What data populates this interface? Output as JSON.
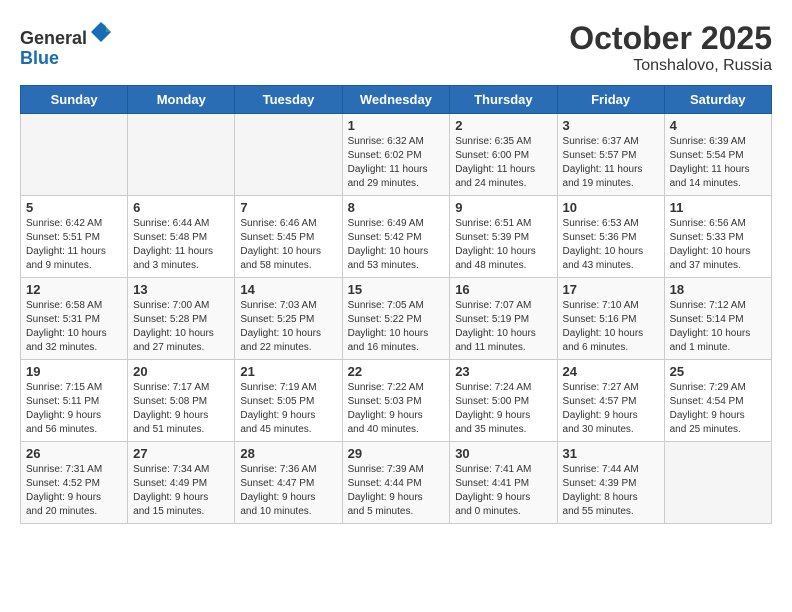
{
  "header": {
    "logo_general": "General",
    "logo_blue": "Blue",
    "title": "October 2025",
    "subtitle": "Tonshalovo, Russia"
  },
  "columns": [
    "Sunday",
    "Monday",
    "Tuesday",
    "Wednesday",
    "Thursday",
    "Friday",
    "Saturday"
  ],
  "weeks": [
    [
      {
        "day": "",
        "info": ""
      },
      {
        "day": "",
        "info": ""
      },
      {
        "day": "",
        "info": ""
      },
      {
        "day": "1",
        "info": "Sunrise: 6:32 AM\nSunset: 6:02 PM\nDaylight: 11 hours\nand 29 minutes."
      },
      {
        "day": "2",
        "info": "Sunrise: 6:35 AM\nSunset: 6:00 PM\nDaylight: 11 hours\nand 24 minutes."
      },
      {
        "day": "3",
        "info": "Sunrise: 6:37 AM\nSunset: 5:57 PM\nDaylight: 11 hours\nand 19 minutes."
      },
      {
        "day": "4",
        "info": "Sunrise: 6:39 AM\nSunset: 5:54 PM\nDaylight: 11 hours\nand 14 minutes."
      }
    ],
    [
      {
        "day": "5",
        "info": "Sunrise: 6:42 AM\nSunset: 5:51 PM\nDaylight: 11 hours\nand 9 minutes."
      },
      {
        "day": "6",
        "info": "Sunrise: 6:44 AM\nSunset: 5:48 PM\nDaylight: 11 hours\nand 3 minutes."
      },
      {
        "day": "7",
        "info": "Sunrise: 6:46 AM\nSunset: 5:45 PM\nDaylight: 10 hours\nand 58 minutes."
      },
      {
        "day": "8",
        "info": "Sunrise: 6:49 AM\nSunset: 5:42 PM\nDaylight: 10 hours\nand 53 minutes."
      },
      {
        "day": "9",
        "info": "Sunrise: 6:51 AM\nSunset: 5:39 PM\nDaylight: 10 hours\nand 48 minutes."
      },
      {
        "day": "10",
        "info": "Sunrise: 6:53 AM\nSunset: 5:36 PM\nDaylight: 10 hours\nand 43 minutes."
      },
      {
        "day": "11",
        "info": "Sunrise: 6:56 AM\nSunset: 5:33 PM\nDaylight: 10 hours\nand 37 minutes."
      }
    ],
    [
      {
        "day": "12",
        "info": "Sunrise: 6:58 AM\nSunset: 5:31 PM\nDaylight: 10 hours\nand 32 minutes."
      },
      {
        "day": "13",
        "info": "Sunrise: 7:00 AM\nSunset: 5:28 PM\nDaylight: 10 hours\nand 27 minutes."
      },
      {
        "day": "14",
        "info": "Sunrise: 7:03 AM\nSunset: 5:25 PM\nDaylight: 10 hours\nand 22 minutes."
      },
      {
        "day": "15",
        "info": "Sunrise: 7:05 AM\nSunset: 5:22 PM\nDaylight: 10 hours\nand 16 minutes."
      },
      {
        "day": "16",
        "info": "Sunrise: 7:07 AM\nSunset: 5:19 PM\nDaylight: 10 hours\nand 11 minutes."
      },
      {
        "day": "17",
        "info": "Sunrise: 7:10 AM\nSunset: 5:16 PM\nDaylight: 10 hours\nand 6 minutes."
      },
      {
        "day": "18",
        "info": "Sunrise: 7:12 AM\nSunset: 5:14 PM\nDaylight: 10 hours\nand 1 minute."
      }
    ],
    [
      {
        "day": "19",
        "info": "Sunrise: 7:15 AM\nSunset: 5:11 PM\nDaylight: 9 hours\nand 56 minutes."
      },
      {
        "day": "20",
        "info": "Sunrise: 7:17 AM\nSunset: 5:08 PM\nDaylight: 9 hours\nand 51 minutes."
      },
      {
        "day": "21",
        "info": "Sunrise: 7:19 AM\nSunset: 5:05 PM\nDaylight: 9 hours\nand 45 minutes."
      },
      {
        "day": "22",
        "info": "Sunrise: 7:22 AM\nSunset: 5:03 PM\nDaylight: 9 hours\nand 40 minutes."
      },
      {
        "day": "23",
        "info": "Sunrise: 7:24 AM\nSunset: 5:00 PM\nDaylight: 9 hours\nand 35 minutes."
      },
      {
        "day": "24",
        "info": "Sunrise: 7:27 AM\nSunset: 4:57 PM\nDaylight: 9 hours\nand 30 minutes."
      },
      {
        "day": "25",
        "info": "Sunrise: 7:29 AM\nSunset: 4:54 PM\nDaylight: 9 hours\nand 25 minutes."
      }
    ],
    [
      {
        "day": "26",
        "info": "Sunrise: 7:31 AM\nSunset: 4:52 PM\nDaylight: 9 hours\nand 20 minutes."
      },
      {
        "day": "27",
        "info": "Sunrise: 7:34 AM\nSunset: 4:49 PM\nDaylight: 9 hours\nand 15 minutes."
      },
      {
        "day": "28",
        "info": "Sunrise: 7:36 AM\nSunset: 4:47 PM\nDaylight: 9 hours\nand 10 minutes."
      },
      {
        "day": "29",
        "info": "Sunrise: 7:39 AM\nSunset: 4:44 PM\nDaylight: 9 hours\nand 5 minutes."
      },
      {
        "day": "30",
        "info": "Sunrise: 7:41 AM\nSunset: 4:41 PM\nDaylight: 9 hours\nand 0 minutes."
      },
      {
        "day": "31",
        "info": "Sunrise: 7:44 AM\nSunset: 4:39 PM\nDaylight: 8 hours\nand 55 minutes."
      },
      {
        "day": "",
        "info": ""
      }
    ]
  ]
}
